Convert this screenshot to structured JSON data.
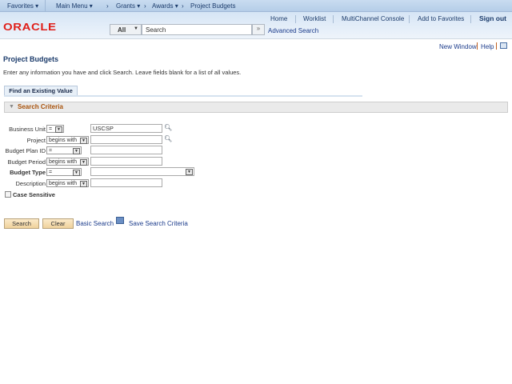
{
  "navbar": {
    "favorites": "Favorites ▾",
    "main_menu": "Main Menu ▾",
    "breadcrumb": [
      "Grants ▾",
      "Awards ▾",
      "Project Budgets"
    ]
  },
  "header": {
    "links": [
      "Home",
      "Worklist",
      "MultiChannel Console",
      "Add to Favorites"
    ],
    "sign_out": "Sign out",
    "logo": "ORACLE",
    "search_scope": "All",
    "search_placeholder": "Search",
    "go": "»",
    "advanced_search": "Advanced Search"
  },
  "page_links": {
    "new_window": "New Window",
    "help": "Help"
  },
  "page": {
    "title": "Project Budgets",
    "instructions": "Enter any information you have and click Search. Leave fields blank for a list of all values.",
    "tab": "Find an Existing Value",
    "section": "Search Criteria"
  },
  "fields": [
    {
      "label": "Business Unit",
      "operator": "=",
      "value": "USCSP"
    },
    {
      "label": "Project",
      "operator": "begins with",
      "value": ""
    },
    {
      "label": "Budget Plan ID",
      "operator": "=",
      "value": ""
    },
    {
      "label": "Budget Period",
      "operator": "begins with",
      "value": ""
    },
    {
      "label": "Budget Type",
      "operator": "=",
      "value": ""
    },
    {
      "label": "Description",
      "operator": "begins with",
      "value": ""
    }
  ],
  "case_sensitive": {
    "label": "Case Sensitive",
    "checked": false
  },
  "actions": {
    "search": "Search",
    "clear": "Clear",
    "basic_search": "Basic Search",
    "save_search": "Save Search Criteria"
  }
}
